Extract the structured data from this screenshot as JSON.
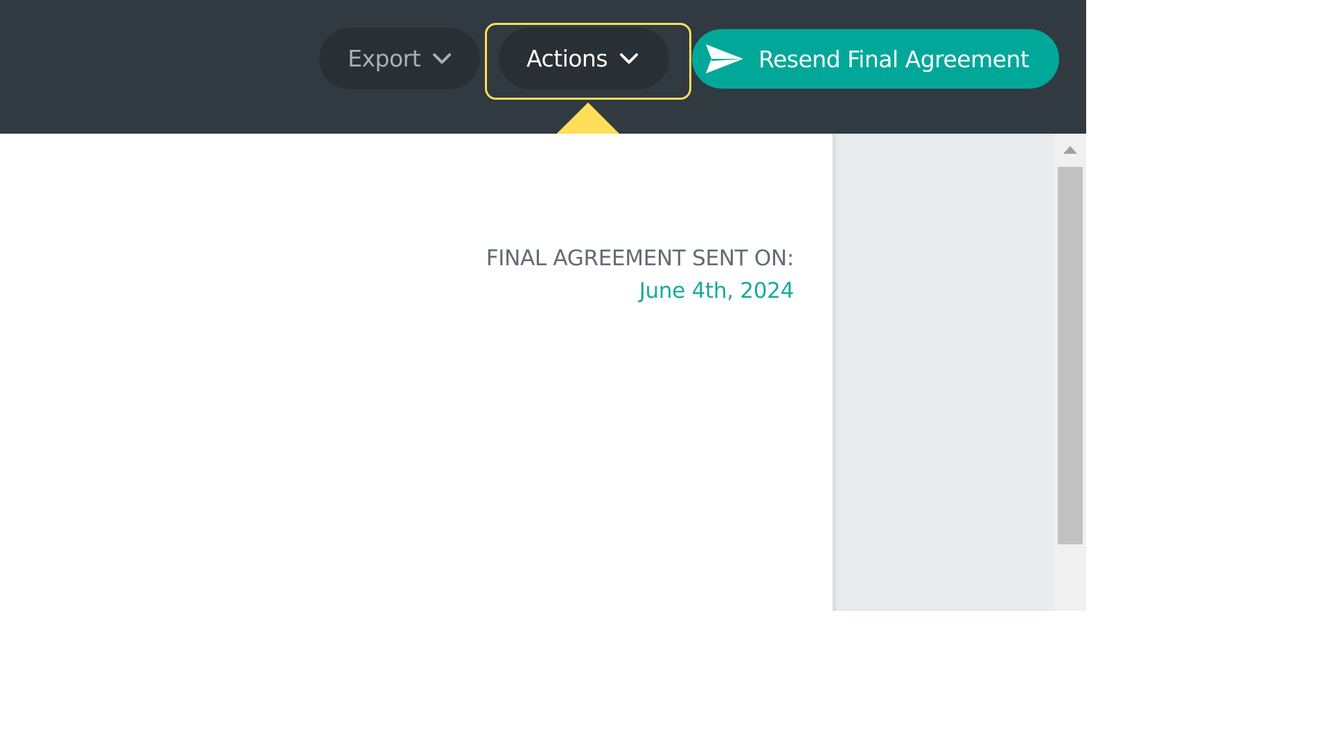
{
  "toolbar": {
    "export_label": "Export",
    "actions_label": "Actions",
    "resend_label": "Resend Final Agreement"
  },
  "content": {
    "sent_label": "FINAL AGREEMENT SENT ON:",
    "sent_date": "June 4th, 2024"
  },
  "icons": {
    "export_chevron": "chevron-down-icon",
    "actions_chevron": "chevron-down-icon",
    "resend_icon": "send-icon",
    "annotation_arrow": "arrow-up-icon"
  },
  "colors": {
    "topbar": "#313a41",
    "button_dark": "#293035",
    "accent_teal": "#01a89a",
    "highlight_yellow": "#ffe05a",
    "date_text": "#19a99d",
    "label_text": "#626b73",
    "side_panel": "#e8ecef"
  }
}
